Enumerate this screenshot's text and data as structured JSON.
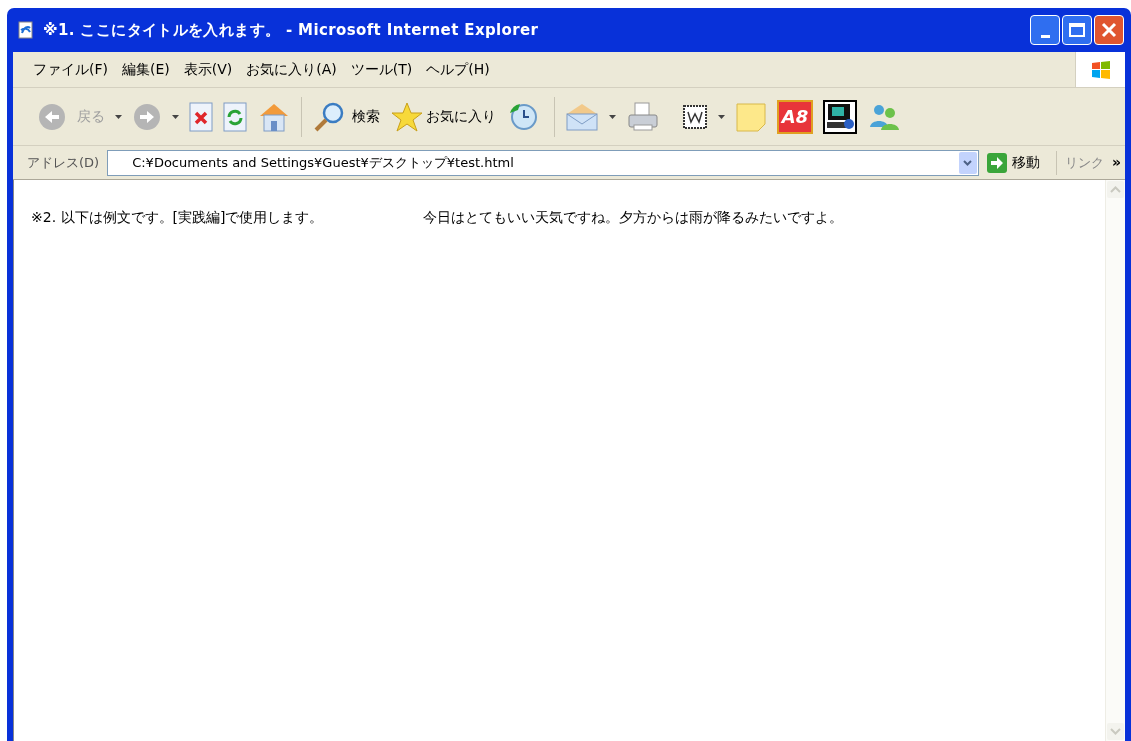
{
  "window": {
    "title": "※1. ここにタイトルを入れます。 - Microsoft Internet Explorer"
  },
  "menu": [
    {
      "label": "ファイル(F)"
    },
    {
      "label": "編集(E)"
    },
    {
      "label": "表示(V)"
    },
    {
      "label": "お気に入り(A)"
    },
    {
      "label": "ツール(T)"
    },
    {
      "label": "ヘルプ(H)"
    }
  ],
  "toolbar": {
    "back": {
      "label": "戻る",
      "disabled": true
    },
    "forward": {
      "disabled": true
    },
    "search": {
      "label": "検索"
    },
    "favorites": {
      "label": "お気に入り"
    },
    "a8": {
      "label": "A8"
    }
  },
  "address_bar": {
    "label": "アドレス(D)",
    "value": "C:¥Documents and Settings¥Guest¥デスクトップ¥test.html",
    "go": "移動",
    "links": "リンク",
    "chevron": "»"
  },
  "content": {
    "texts": [
      "※2. 以下は例文です。[実践編]で使用します。",
      "今日はとてもいい天気ですね。夕方からは雨が降るみたいですよ。"
    ]
  }
}
